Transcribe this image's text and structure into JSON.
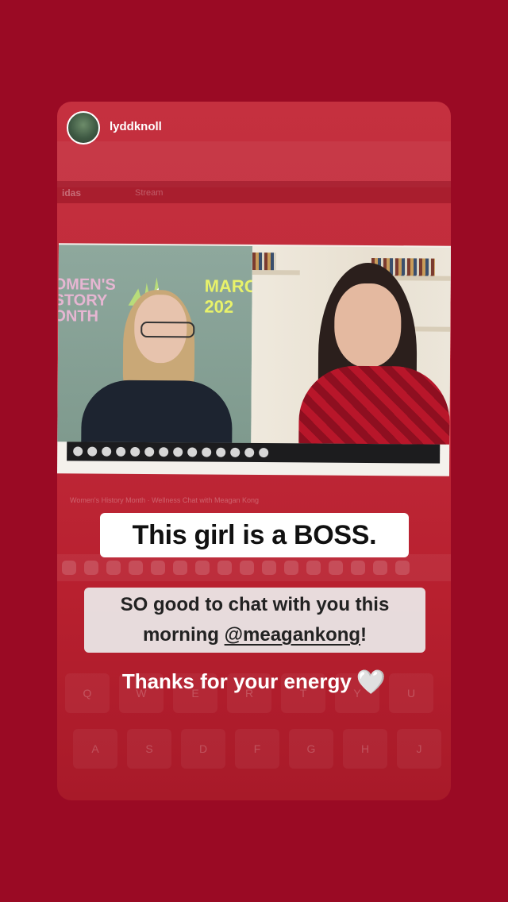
{
  "profile": {
    "username": "lyddknoll"
  },
  "background_ui": {
    "brand": "idas",
    "stream_label": "Stream",
    "caption": "Women's History Month · Wellness Chat with Meagan Kong",
    "keys_row1": [
      "Q",
      "W",
      "E",
      "R",
      "T",
      "Y",
      "U"
    ],
    "keys_row2": [
      "A",
      "S",
      "D",
      "F",
      "G",
      "H",
      "J"
    ]
  },
  "call": {
    "banner_left": "OMEN'S\nSTORY\nONTH",
    "banner_right": "MARC\n202"
  },
  "stickers": {
    "headline": "This girl is a BOSS.",
    "message_line1": "SO good to chat with you this",
    "message_line2_pre": "morning ",
    "message_mention": "@meagankong",
    "message_line2_post": "!",
    "thanks": "Thanks for your energy",
    "heart": "🤍"
  },
  "colors": {
    "background": "#9a0a24",
    "story_tint": "#c02a3a",
    "headline_box": "#ffffff",
    "message_box": "#ebebeb"
  }
}
